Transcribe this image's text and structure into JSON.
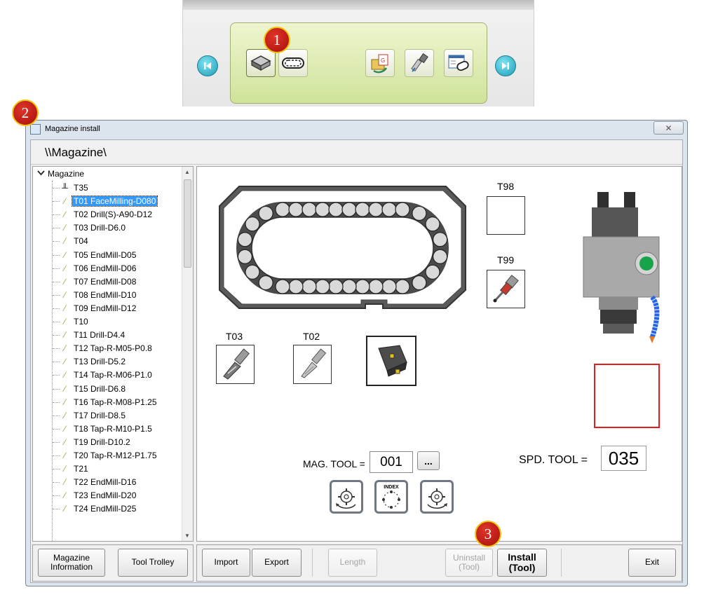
{
  "toolbar": {
    "badge": "1",
    "buttons": [
      "first-icon",
      "magazine-install-icon",
      "magazine-ring-icon",
      "gcode-export-icon",
      "tool-holder-icon",
      "tool-setting-icon",
      "last-icon"
    ]
  },
  "window": {
    "badge": "2",
    "title": "Magazine install",
    "close_label": "✕",
    "path": "\\\\Magazine\\"
  },
  "tree": {
    "root": "Magazine",
    "items": [
      {
        "label": "T35",
        "icon": "spindle-icon"
      },
      {
        "label": "T01 FaceMilling-D080",
        "icon": "tool-icon",
        "selected": true
      },
      {
        "label": "T02 Drill(S)-A90-D12",
        "icon": "tool-icon"
      },
      {
        "label": "T03 Drill-D6.0",
        "icon": "tool-icon"
      },
      {
        "label": "T04",
        "icon": "tool-icon"
      },
      {
        "label": "T05 EndMill-D05",
        "icon": "tool-icon"
      },
      {
        "label": "T06 EndMill-D06",
        "icon": "tool-icon"
      },
      {
        "label": "T07 EndMill-D08",
        "icon": "tool-icon"
      },
      {
        "label": "T08 EndMill-D10",
        "icon": "tool-icon"
      },
      {
        "label": "T09 EndMill-D12",
        "icon": "tool-icon"
      },
      {
        "label": "T10",
        "icon": "tool-icon"
      },
      {
        "label": "T11 Drill-D4.4",
        "icon": "tool-icon"
      },
      {
        "label": "T12 Tap-R-M05-P0.8",
        "icon": "tool-icon"
      },
      {
        "label": "T13 Drill-D5.2",
        "icon": "tool-icon"
      },
      {
        "label": "T14 Tap-R-M06-P1.0",
        "icon": "tool-icon"
      },
      {
        "label": "T15 Drill-D6.8",
        "icon": "tool-icon"
      },
      {
        "label": "T16 Tap-R-M08-P1.25",
        "icon": "tool-icon"
      },
      {
        "label": "T17 Drill-D8.5",
        "icon": "tool-icon"
      },
      {
        "label": "T18 Tap-R-M10-P1.5",
        "icon": "tool-icon"
      },
      {
        "label": "T19 Drill-D10.2",
        "icon": "tool-icon"
      },
      {
        "label": "T20 Tap-R-M12-P1.75",
        "icon": "tool-icon"
      },
      {
        "label": "T21",
        "icon": "tool-icon"
      },
      {
        "label": "T22 EndMill-D16",
        "icon": "tool-icon"
      },
      {
        "label": "T23 EndMill-D20",
        "icon": "tool-icon"
      },
      {
        "label": "T24 EndMill-D25",
        "icon": "tool-icon"
      }
    ]
  },
  "main": {
    "t98_label": "T98",
    "t99_label": "T99",
    "t03_label": "T03",
    "t02_label": "T02",
    "mag_tool_label": "MAG. TOOL =",
    "mag_tool_value": "001",
    "browse_label": "...",
    "index_label": "INDEX",
    "spd_tool_label": "SPD. TOOL =",
    "spd_tool_value": "035"
  },
  "buttons": {
    "magazine_info": "Magazine\nInformation",
    "tool_trolley": "Tool Trolley",
    "import": "Import",
    "export": "Export",
    "length": "Length",
    "uninstall": "Uninstall\n(Tool)",
    "install": "Install\n(Tool)",
    "install_badge": "3",
    "exit": "Exit"
  },
  "colors": {
    "selection": "#3399ff",
    "spindle_box_border": "#e11d1d",
    "badge": "#b5160f",
    "toolbar_panel": "#d8e8a8"
  }
}
